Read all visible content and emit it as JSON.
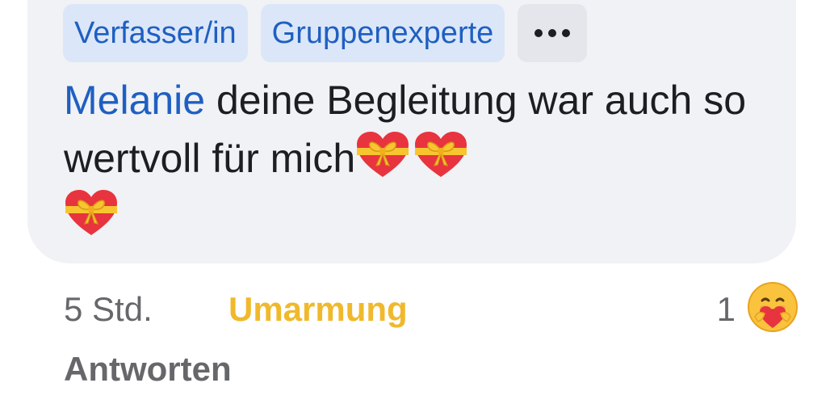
{
  "badges": {
    "author": "Verfasser/in",
    "expert": "Gruppenexperte"
  },
  "more_icon": "more-dots-icon",
  "comment": {
    "mention": "Melanie",
    "text": " deine Begleitung war auch so wertvoll für mich",
    "emoji": [
      "heart-with-ribbon",
      "heart-with-ribbon",
      "heart-with-ribbon"
    ]
  },
  "meta": {
    "time": "5 Std.",
    "reaction_label": "Umarmung",
    "reaction_count": "1",
    "reaction_icon": "care-hug-emoji"
  },
  "reply_label": "Antworten",
  "colors": {
    "bubble_bg": "#f0f2f5",
    "badge_bg": "#dbe7f8",
    "link_blue": "#1f5fc2",
    "reaction_gold": "#f0b92c",
    "meta_gray": "#65676b"
  }
}
